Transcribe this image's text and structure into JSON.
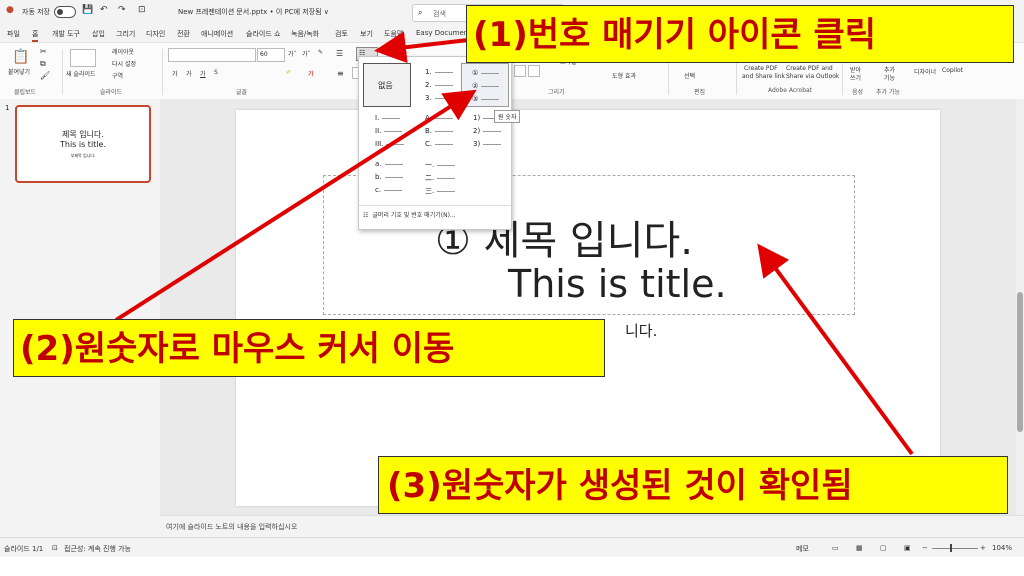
{
  "titlebar": {
    "autosave_label": "자동 저장",
    "toggle_state": "끔",
    "document_title": "New 프레젠테이션 문서.pptx • 이 PC에 저장됨 ∨",
    "search_placeholder": "검색"
  },
  "menu": {
    "tabs": [
      "파일",
      "홈",
      "개발 도구",
      "삽입",
      "그리기",
      "디자인",
      "전환",
      "애니메이션",
      "슬라이드 쇼",
      "녹음/녹화",
      "검토",
      "보기",
      "도움말",
      "Easy Document"
    ],
    "active": "홈"
  },
  "ribbon": {
    "paste_label": "붙여넣기",
    "new_slide_label": "새 슬라이드",
    "layout_label": "레이아웃",
    "reset_label": "다시 설정",
    "section_label": "구역",
    "font_size": "60",
    "groups": {
      "clipboard": "클립보드",
      "slides": "슬라이드",
      "font": "글꼴",
      "drawing": "그리기",
      "editing": "편집",
      "acrobat": "Adobe Acrobat",
      "voice": "음성",
      "addins": "추가 기능"
    },
    "shape_label": "도형 효과",
    "style_label": "스타일",
    "select_label": "선택",
    "pdf1": "Create PDF",
    "pdf1b": "and Share link",
    "pdf2": "Create PDF and",
    "pdf2b": "Share via Outlook",
    "dictate": "받아",
    "dictate2": "쓰기",
    "addin": "추가",
    "addin2": "기능",
    "designer": "디자이너",
    "copilot": "Copilot"
  },
  "numbering_dropdown": {
    "none_label": "없음",
    "col1": [
      "1.",
      "2.",
      "3."
    ],
    "col2": [
      "①",
      "②",
      "③"
    ],
    "col3": [
      "I.",
      "II.",
      "III."
    ],
    "col4": [
      "A.",
      "B.",
      "C."
    ],
    "col5": [
      "1)",
      "2)",
      "3)"
    ],
    "col6": [
      "a.",
      "b.",
      "c."
    ],
    "col7": [
      "一.",
      "二.",
      "三."
    ],
    "footer": "글머리 기호 및 번호 매기기(N)...",
    "tooltip": "원 숫자"
  },
  "thumbnail": {
    "number": "1",
    "line1": "제목 입니다.",
    "line2": "This is title.",
    "line3": "부제목 입니다."
  },
  "slide": {
    "title_line1": "①  제목 입니다.",
    "title_line2": "This is title.",
    "subtitle_fragment": "니다."
  },
  "notes": {
    "placeholder": "여기에 슬라이드 노트의 내용을 입력하십시오"
  },
  "status": {
    "slide_count": "슬라이드 1/1",
    "accessibility": "접근성: 계속 진행 가능",
    "notes_button": "메모",
    "zoom": "104%"
  },
  "annotations": {
    "step1": "(1)번호 매기기 아이콘 클릭",
    "step2": "(2)원숫자로 마우스 커서 이동",
    "step3": "(3)원숫자가 생성된 것이 확인됨"
  },
  "colors": {
    "accent": "#b7472a",
    "callout_bg": "#ffff00",
    "callout_text": "#c00000",
    "arrow": "#e00000"
  }
}
